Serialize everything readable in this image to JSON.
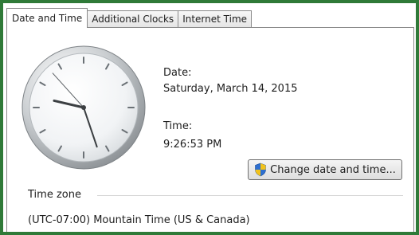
{
  "tabs": [
    {
      "label": "Date and Time",
      "active": true
    },
    {
      "label": "Additional Clocks",
      "active": false
    },
    {
      "label": "Internet Time",
      "active": false
    }
  ],
  "clock": {
    "time_shown": "9:26:53 PM"
  },
  "date": {
    "label": "Date:",
    "value": "Saturday, March 14, 2015"
  },
  "time": {
    "label": "Time:",
    "value": "9:26:53 PM"
  },
  "change_button": {
    "label": "Change date and time...",
    "icon": "uac-shield-icon"
  },
  "time_zone": {
    "heading": "Time zone",
    "value": "(UTC-07:00) Mountain Time (US & Canada)"
  },
  "colors": {
    "frame_border": "#2f7a38",
    "shield_blue": "#2d6fd0",
    "shield_yellow": "#f2c21b"
  }
}
